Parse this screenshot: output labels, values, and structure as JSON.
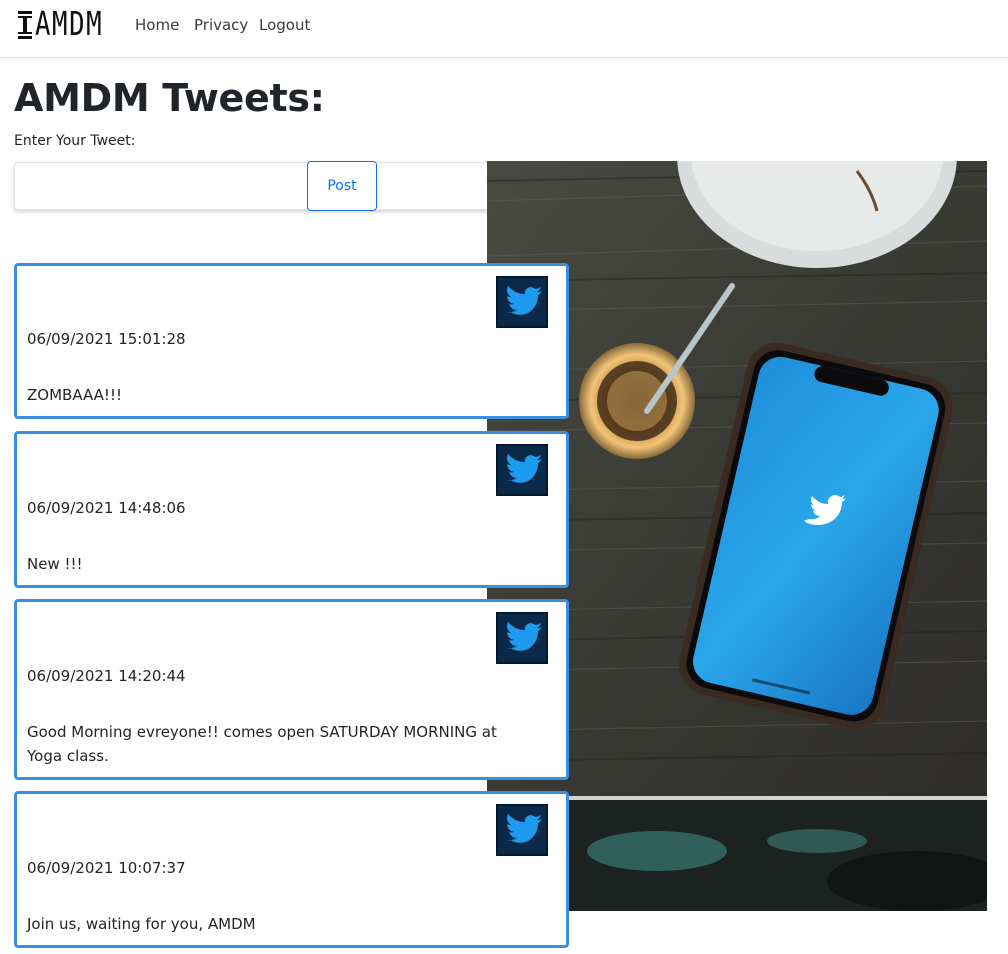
{
  "nav": {
    "brand": "AMDM",
    "links": [
      "Home",
      "Privacy",
      "Logout"
    ]
  },
  "main": {
    "title": "AMDM Tweets:",
    "input_label": "Enter Your Tweet:",
    "input_value": "",
    "post_label": "Post"
  },
  "tweets": [
    {
      "time": "06/09/2021 15:01:28",
      "text": "ZOMBAAA!!!"
    },
    {
      "time": "06/09/2021 14:48:06",
      "text": "New !!!"
    },
    {
      "time": "06/09/2021 14:20:44",
      "text": "Good Morning evreyone!! comes open SATURDAY MORNING at Yoga class."
    },
    {
      "time": "06/09/2021 10:07:37",
      "text": "Join us, waiting for you, AMDM"
    }
  ],
  "colors": {
    "accent": "#0d6efd",
    "card_border": "#3a8fe0",
    "twitter_blue": "#1d9bf0"
  },
  "icons": {
    "brand": "dumbbell-logo-icon",
    "tweet": "twitter-bird-icon"
  }
}
